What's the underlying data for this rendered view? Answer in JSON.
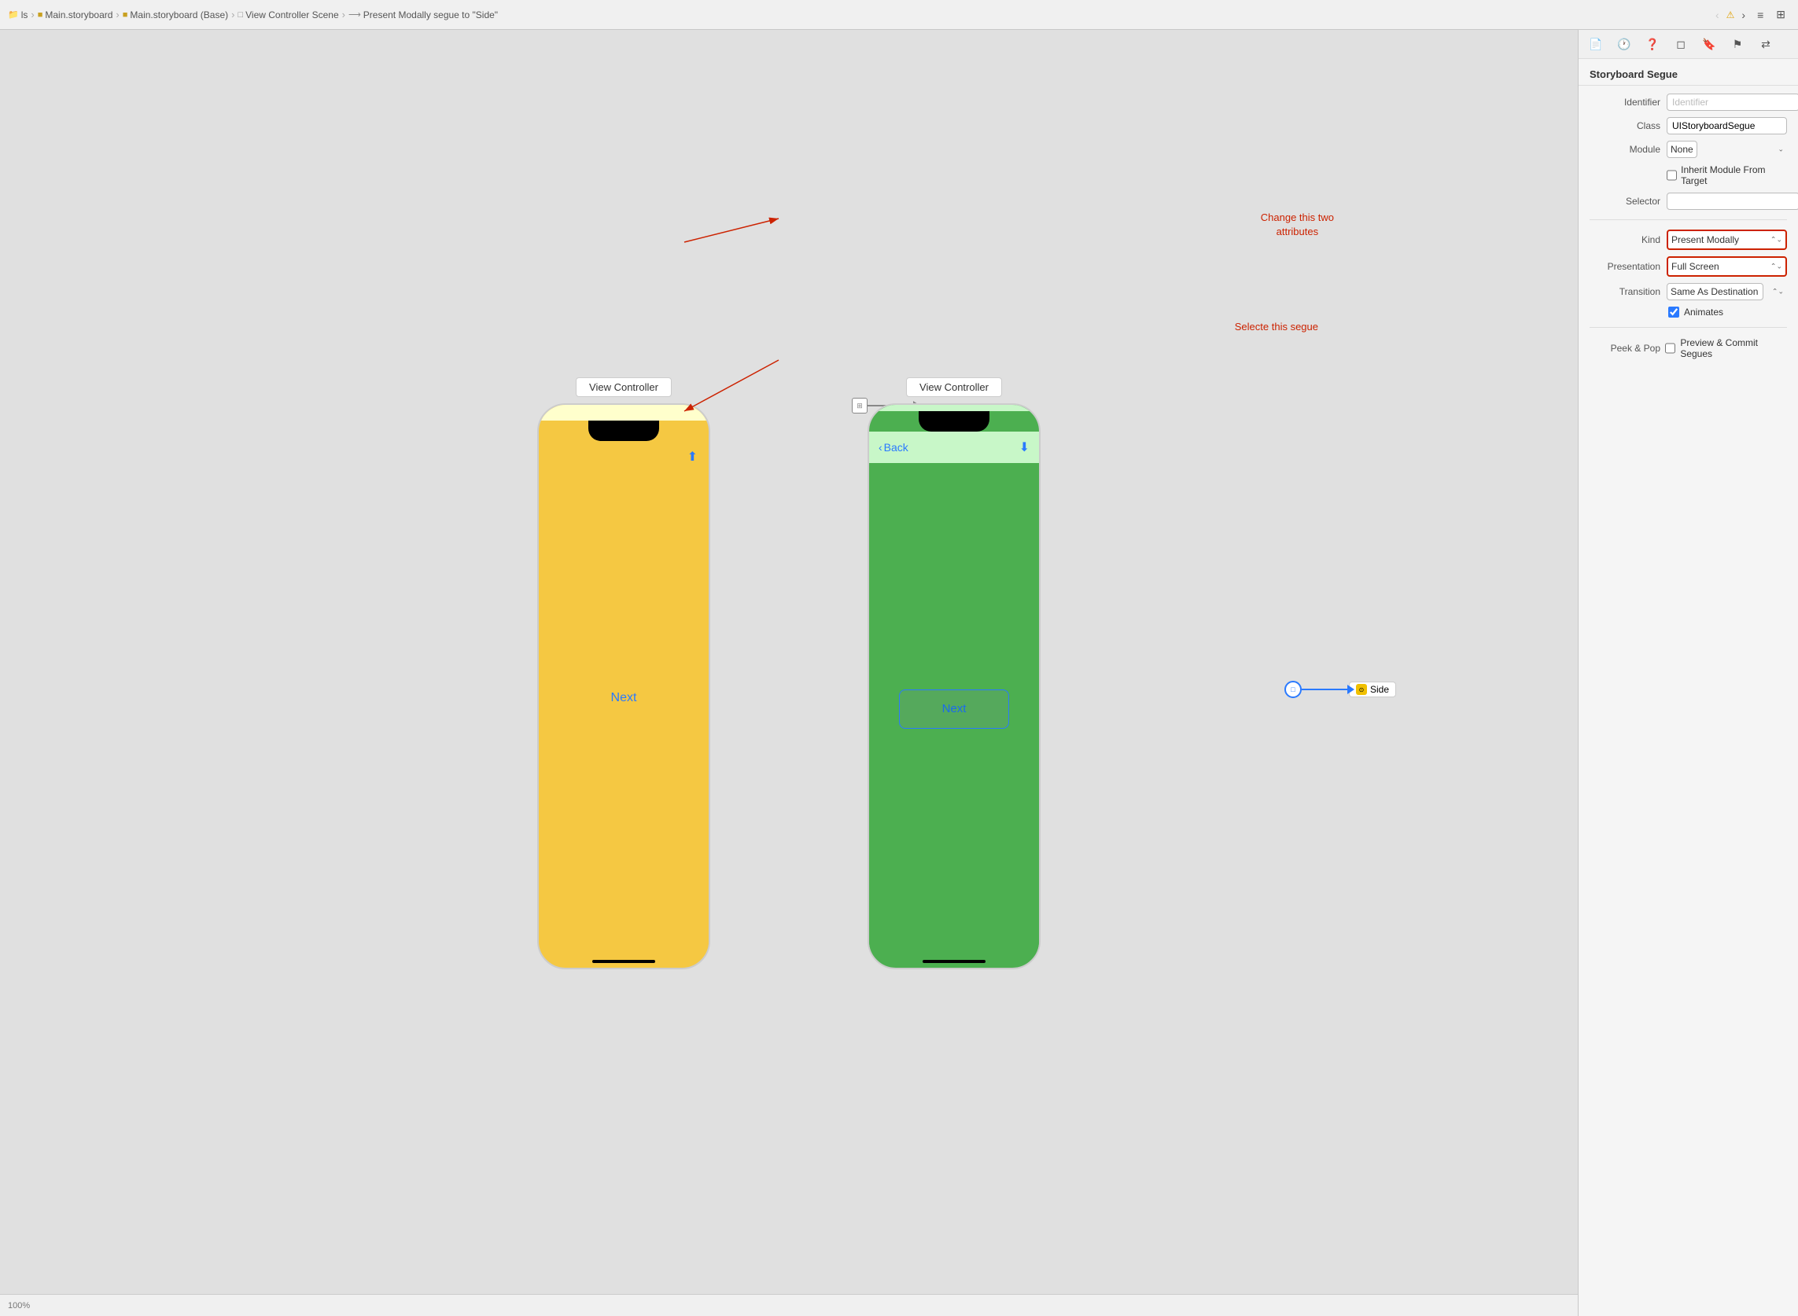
{
  "toolbar": {
    "breadcrumbs": [
      {
        "label": "ls",
        "icon": "folder"
      },
      {
        "label": "Main.storyboard",
        "icon": "storyboard"
      },
      {
        "label": "Main.storyboard (Base)",
        "icon": "storyboard"
      },
      {
        "label": "View Controller Scene",
        "icon": "vc"
      },
      {
        "label": "Present Modally segue to \"Side\"",
        "icon": "segue"
      }
    ],
    "nav_back": "‹",
    "nav_forward": "›",
    "warning_icon": "⚠",
    "list_icon": "≡",
    "grid_icon": "⊞"
  },
  "canvas": {
    "scene1_label": "View Controller",
    "scene2_label": "View Controller",
    "phone1_next_text": "Next",
    "phone2_next_text": "Next",
    "phone2_back_text": "Back",
    "segue_annotation_text": "Change this two\nattributes",
    "select_annotation_text": "Selecte this segue",
    "side_label": "Side"
  },
  "inspector": {
    "title": "Storyboard Segue",
    "identifier_label": "Identifier",
    "identifier_placeholder": "Identifier",
    "class_label": "Class",
    "class_value": "UIStoryboardSegue",
    "module_label": "Module",
    "module_value": "None",
    "inherit_label": "Inherit Module From Target",
    "selector_label": "Selector",
    "kind_label": "Kind",
    "kind_value": "Present Modally",
    "presentation_label": "Presentation",
    "presentation_value": "Full Screen",
    "transition_label": "Transition",
    "transition_value": "Same As Destination",
    "animates_label": "Animates",
    "peek_pop_label": "Peek & Pop",
    "preview_commit_label": "Preview & Commit Segues",
    "icons": {
      "class_settings": "⚙",
      "class_arrow": "→",
      "stepper_up": "▲",
      "stepper_down": "▼",
      "module_chevron": "⌄"
    }
  }
}
